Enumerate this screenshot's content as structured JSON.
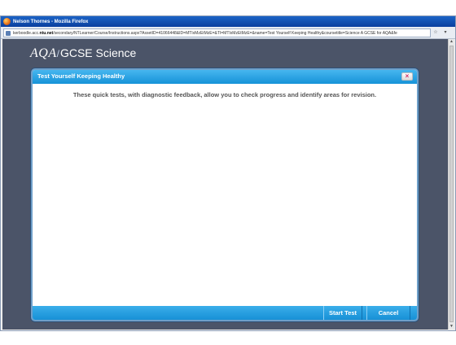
{
  "browser": {
    "title": "Nelson Thornes - Mozilla Firefox",
    "url_prefix": "kerboodle.acc.",
    "url_domain": "ntu.net",
    "url_rest": "/secondary/NTLearner/Course/Instructions.aspx?AssetID=41066448&ID=MTIxMzEtMzE=&TI=MTIxMzEtMzE=&name=Test Yourself Keeping Healthy&coursetitle=Science A GCSE for AQA&fe"
  },
  "logo": {
    "brand": "AQA",
    "product": "GCSE Science"
  },
  "dialog": {
    "title": "Test Yourself Keeping Healthy",
    "close_glyph": "×",
    "message": "These quick tests, with diagnostic feedback, allow you to check progress and identify areas for revision.",
    "start_label": "Start Test",
    "cancel_label": "Cancel"
  },
  "colors": {
    "page_background": "#4b5468",
    "header_blue": "#1693d8",
    "close_x": "#d02a64"
  }
}
